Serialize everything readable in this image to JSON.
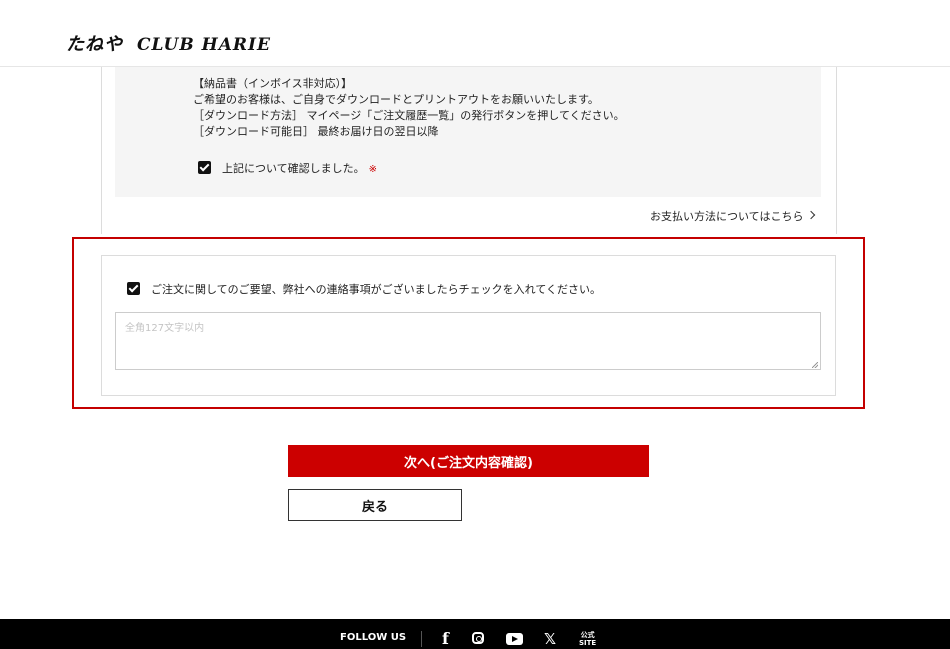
{
  "header": {
    "logo_primary": "たねや",
    "logo_secondary": "CLUB HARIE"
  },
  "invoice_notice": {
    "title": "【納品書（インボイス非対応）】",
    "line1": "ご希望のお客様は、ご自身でダウンロードとプリントアウトをお願いいたします。",
    "line2": "［ダウンロード方法］ マイページ「ご注文履歴一覧」の発行ボタンを押してください。",
    "line3": "［ダウンロード可能日］ 最終お届け日の翌日以降",
    "confirm_label": "上記について確認しました。",
    "required_mark": "※"
  },
  "payment_link": "お支払い方法についてはこちら",
  "request": {
    "checkbox_label": "ご注文に関してのご要望、弊社への連絡事項がございましたらチェックを入れてください。",
    "placeholder": "全角127文字以内",
    "value": ""
  },
  "buttons": {
    "next": "次へ(ご注文内容確認)",
    "back": "戻る"
  },
  "footer": {
    "follow_us": "FOLLOW US",
    "facebook": "f",
    "x": "𝕏",
    "official_line1": "公式",
    "official_line2": "SITE"
  },
  "colors": {
    "accent": "#cc0000",
    "highlight_frame": "#c40000",
    "footer_bg": "#000000"
  }
}
